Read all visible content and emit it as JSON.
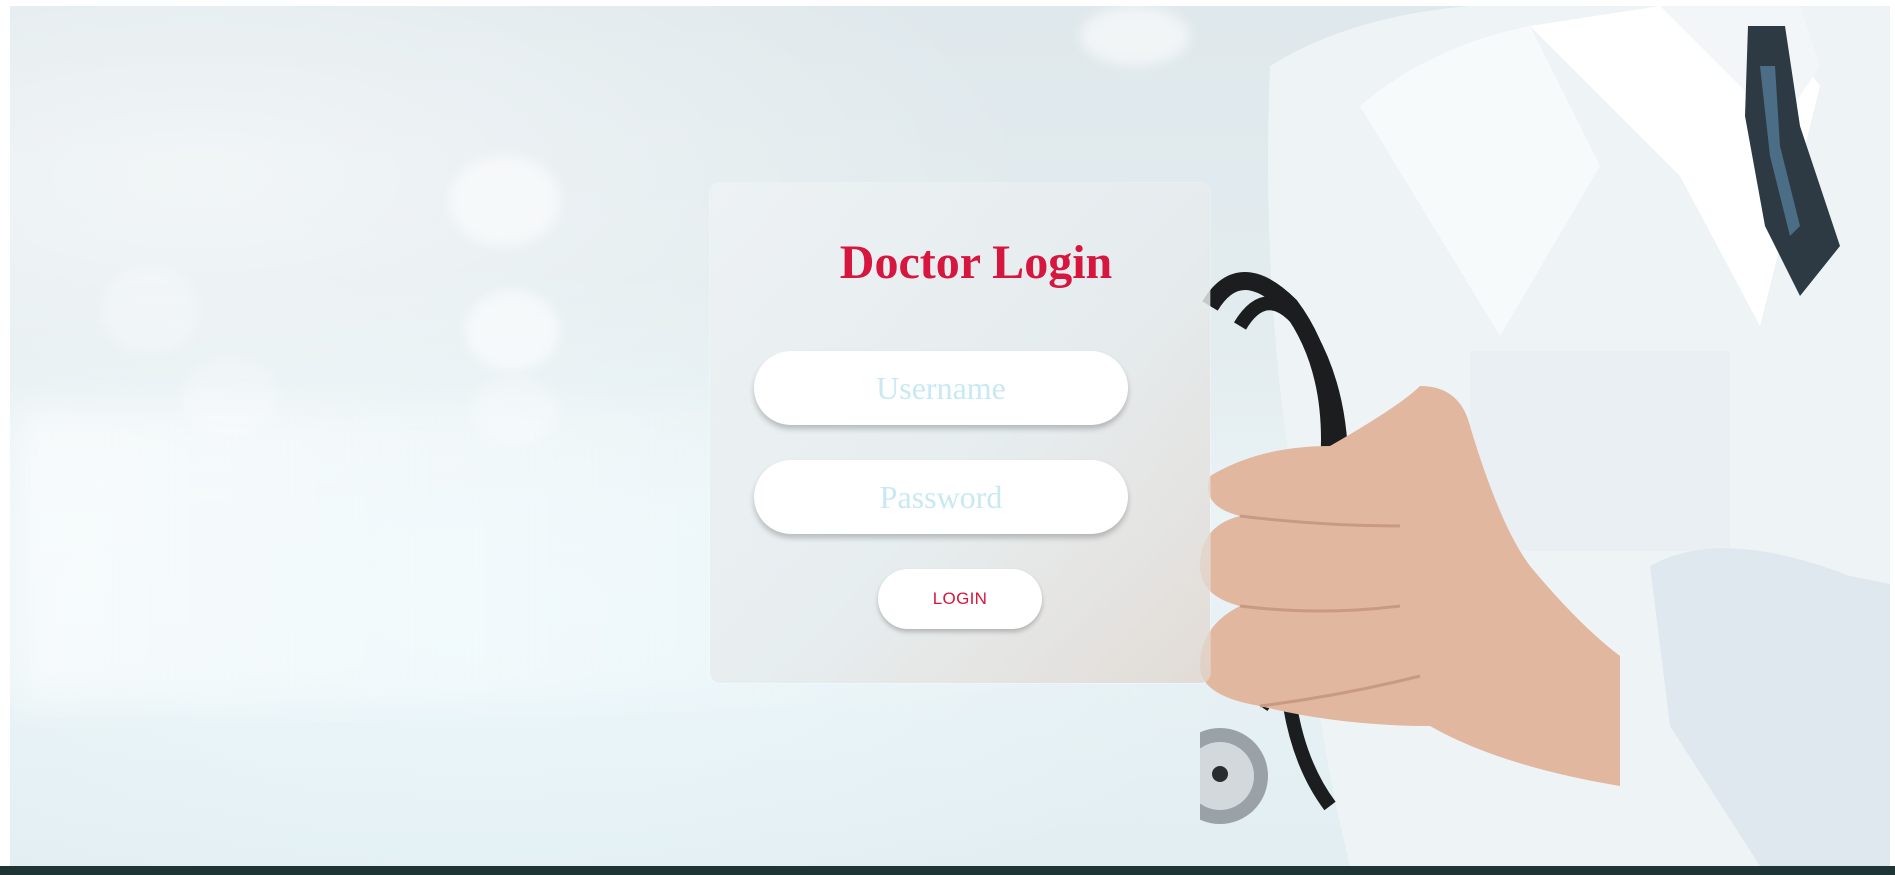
{
  "page": {
    "title": "Doctor Login"
  },
  "login": {
    "title": "Doctor Login",
    "username_placeholder": "Username",
    "password_placeholder": "Password",
    "button_label": "LOGIN"
  },
  "colors": {
    "accent": "#d6163f",
    "placeholder": "#c8e9f4",
    "taskbar": "#1f3434"
  },
  "icons": {
    "background_image": "doctor-with-stethoscope-photo"
  }
}
